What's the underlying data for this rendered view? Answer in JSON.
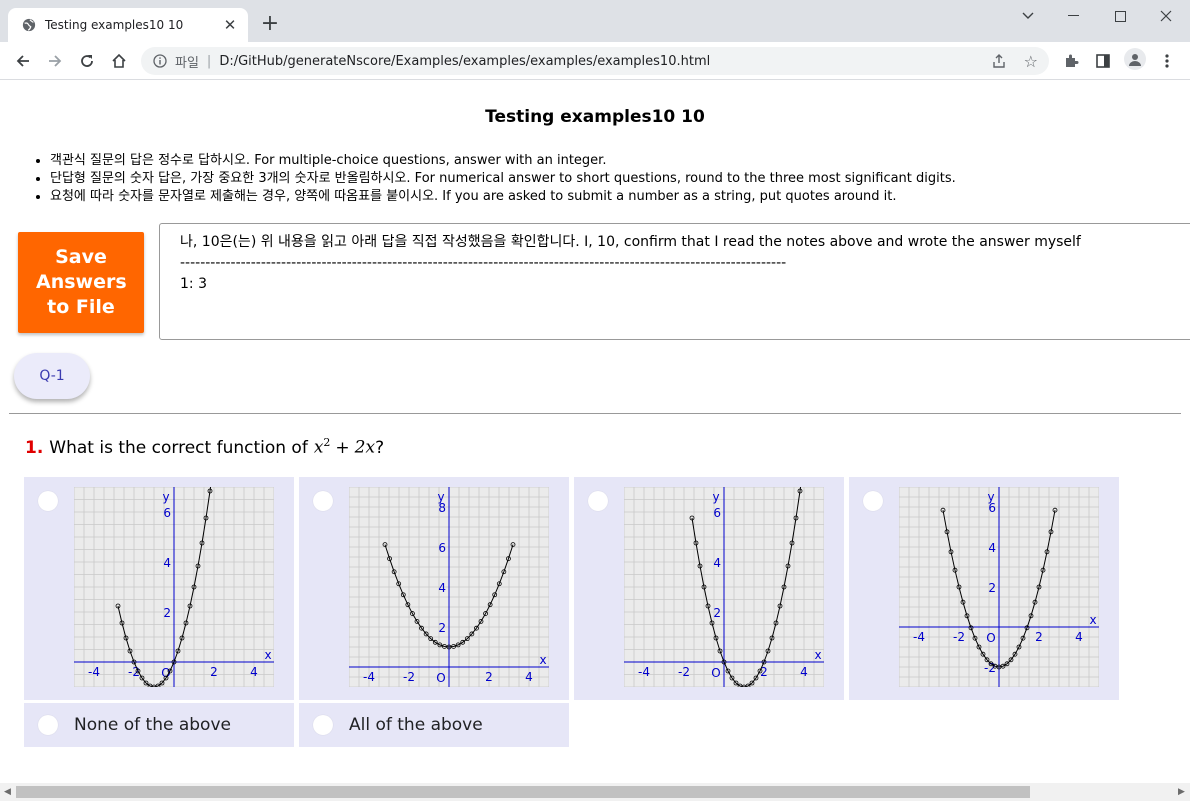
{
  "browser": {
    "tab_title": "Testing examples10 10",
    "omnibox_scheme": "파일",
    "omnibox_url": "D:/GitHub/generateNscore/Examples/examples/examples/examples10.html",
    "icons": [
      "globe-icon",
      "close-icon",
      "plus-icon",
      "back-icon",
      "forward-icon",
      "reload-icon",
      "home-icon",
      "info-icon",
      "share-icon",
      "star-icon",
      "extensions-icon",
      "sidepanel-icon",
      "profile-icon",
      "kebab-menu-icon"
    ]
  },
  "page": {
    "title": "Testing examples10 10",
    "notes": [
      "객관식 질문의 답은 정수로 답하시오. For multiple-choice questions, answer with an integer.",
      "단답형 질문의 숫자 답은, 가장 중요한 3개의 숫자로 반올림하시오. For numerical answer to short questions, round to the three most significant digits.",
      "요청에 따라 숫자를 문자열로 제출해는 경우, 양쪽에 따옴표를 붙이시오. If you are asked to submit a number as a string, put quotes around it."
    ],
    "save_button": "Save Answers to File",
    "answer_box": {
      "line1": "나, 10은(는) 위 내용을 읽고 아래 답을 직접 작성했음을 확인합니다. I, 10, confirm that I read the notes above and wrote the answer myself",
      "line2": "------------------------------------------------------------------------------------------------------------------------",
      "line3": "1: 3"
    },
    "question_nav_button": "Q-1",
    "question": {
      "number": "1.",
      "prefix": "What is the correct function of",
      "math_base": "x",
      "math_exp": "2",
      "math_op": "+",
      "math_term": "2x",
      "suffix": "?"
    },
    "options_text": {
      "none": "None of the above",
      "all": "All of the above"
    },
    "colors": {
      "save_button": "#ff6600",
      "option_background": "#e6e6f7",
      "question_number": "#e00000",
      "axis": "#0000cc"
    }
  },
  "chart_data": [
    {
      "type": "line",
      "function": "y = x^2 + 2x",
      "x": [
        -2.8,
        2.8
      ],
      "xlim": [
        -5,
        5
      ],
      "ylim": [
        -1,
        7
      ],
      "x_ticks": [
        "-4",
        "-2",
        "2",
        "4"
      ],
      "y_ticks": [
        "2",
        "4",
        "6"
      ],
      "xlabel": "x",
      "ylabel": "y",
      "origin_label": "O",
      "grid": true
    },
    {
      "type": "line",
      "function": "y = x^2/2 + 1",
      "x": [
        -3.2,
        3.2
      ],
      "xlim": [
        -5,
        5
      ],
      "ylim": [
        -1,
        9
      ],
      "x_ticks": [
        "-4",
        "-2",
        "2",
        "4"
      ],
      "y_ticks": [
        "2",
        "4",
        "6",
        "8"
      ],
      "xlabel": "x",
      "ylabel": "y",
      "origin_label": "O",
      "grid": true
    },
    {
      "type": "line",
      "function": "y = x^2 - 2x",
      "x": [
        -1.6,
        4.0
      ],
      "xlim": [
        -5,
        5
      ],
      "ylim": [
        -1,
        7
      ],
      "x_ticks": [
        "-4",
        "-2",
        "2",
        "4"
      ],
      "y_ticks": [
        "2",
        "4",
        "6"
      ],
      "xlabel": "x",
      "ylabel": "y",
      "origin_label": "O",
      "grid": true
    },
    {
      "type": "line",
      "function": "y = x^2 - 2",
      "x": [
        -2.8,
        2.8
      ],
      "xlim": [
        -5,
        5
      ],
      "ylim": [
        -3,
        7
      ],
      "x_ticks": [
        "-4",
        "-2",
        "2",
        "4"
      ],
      "y_ticks": [
        "-2",
        "2",
        "4",
        "6"
      ],
      "xlabel": "x",
      "ylabel": "y",
      "origin_label": "O",
      "grid": true
    }
  ]
}
